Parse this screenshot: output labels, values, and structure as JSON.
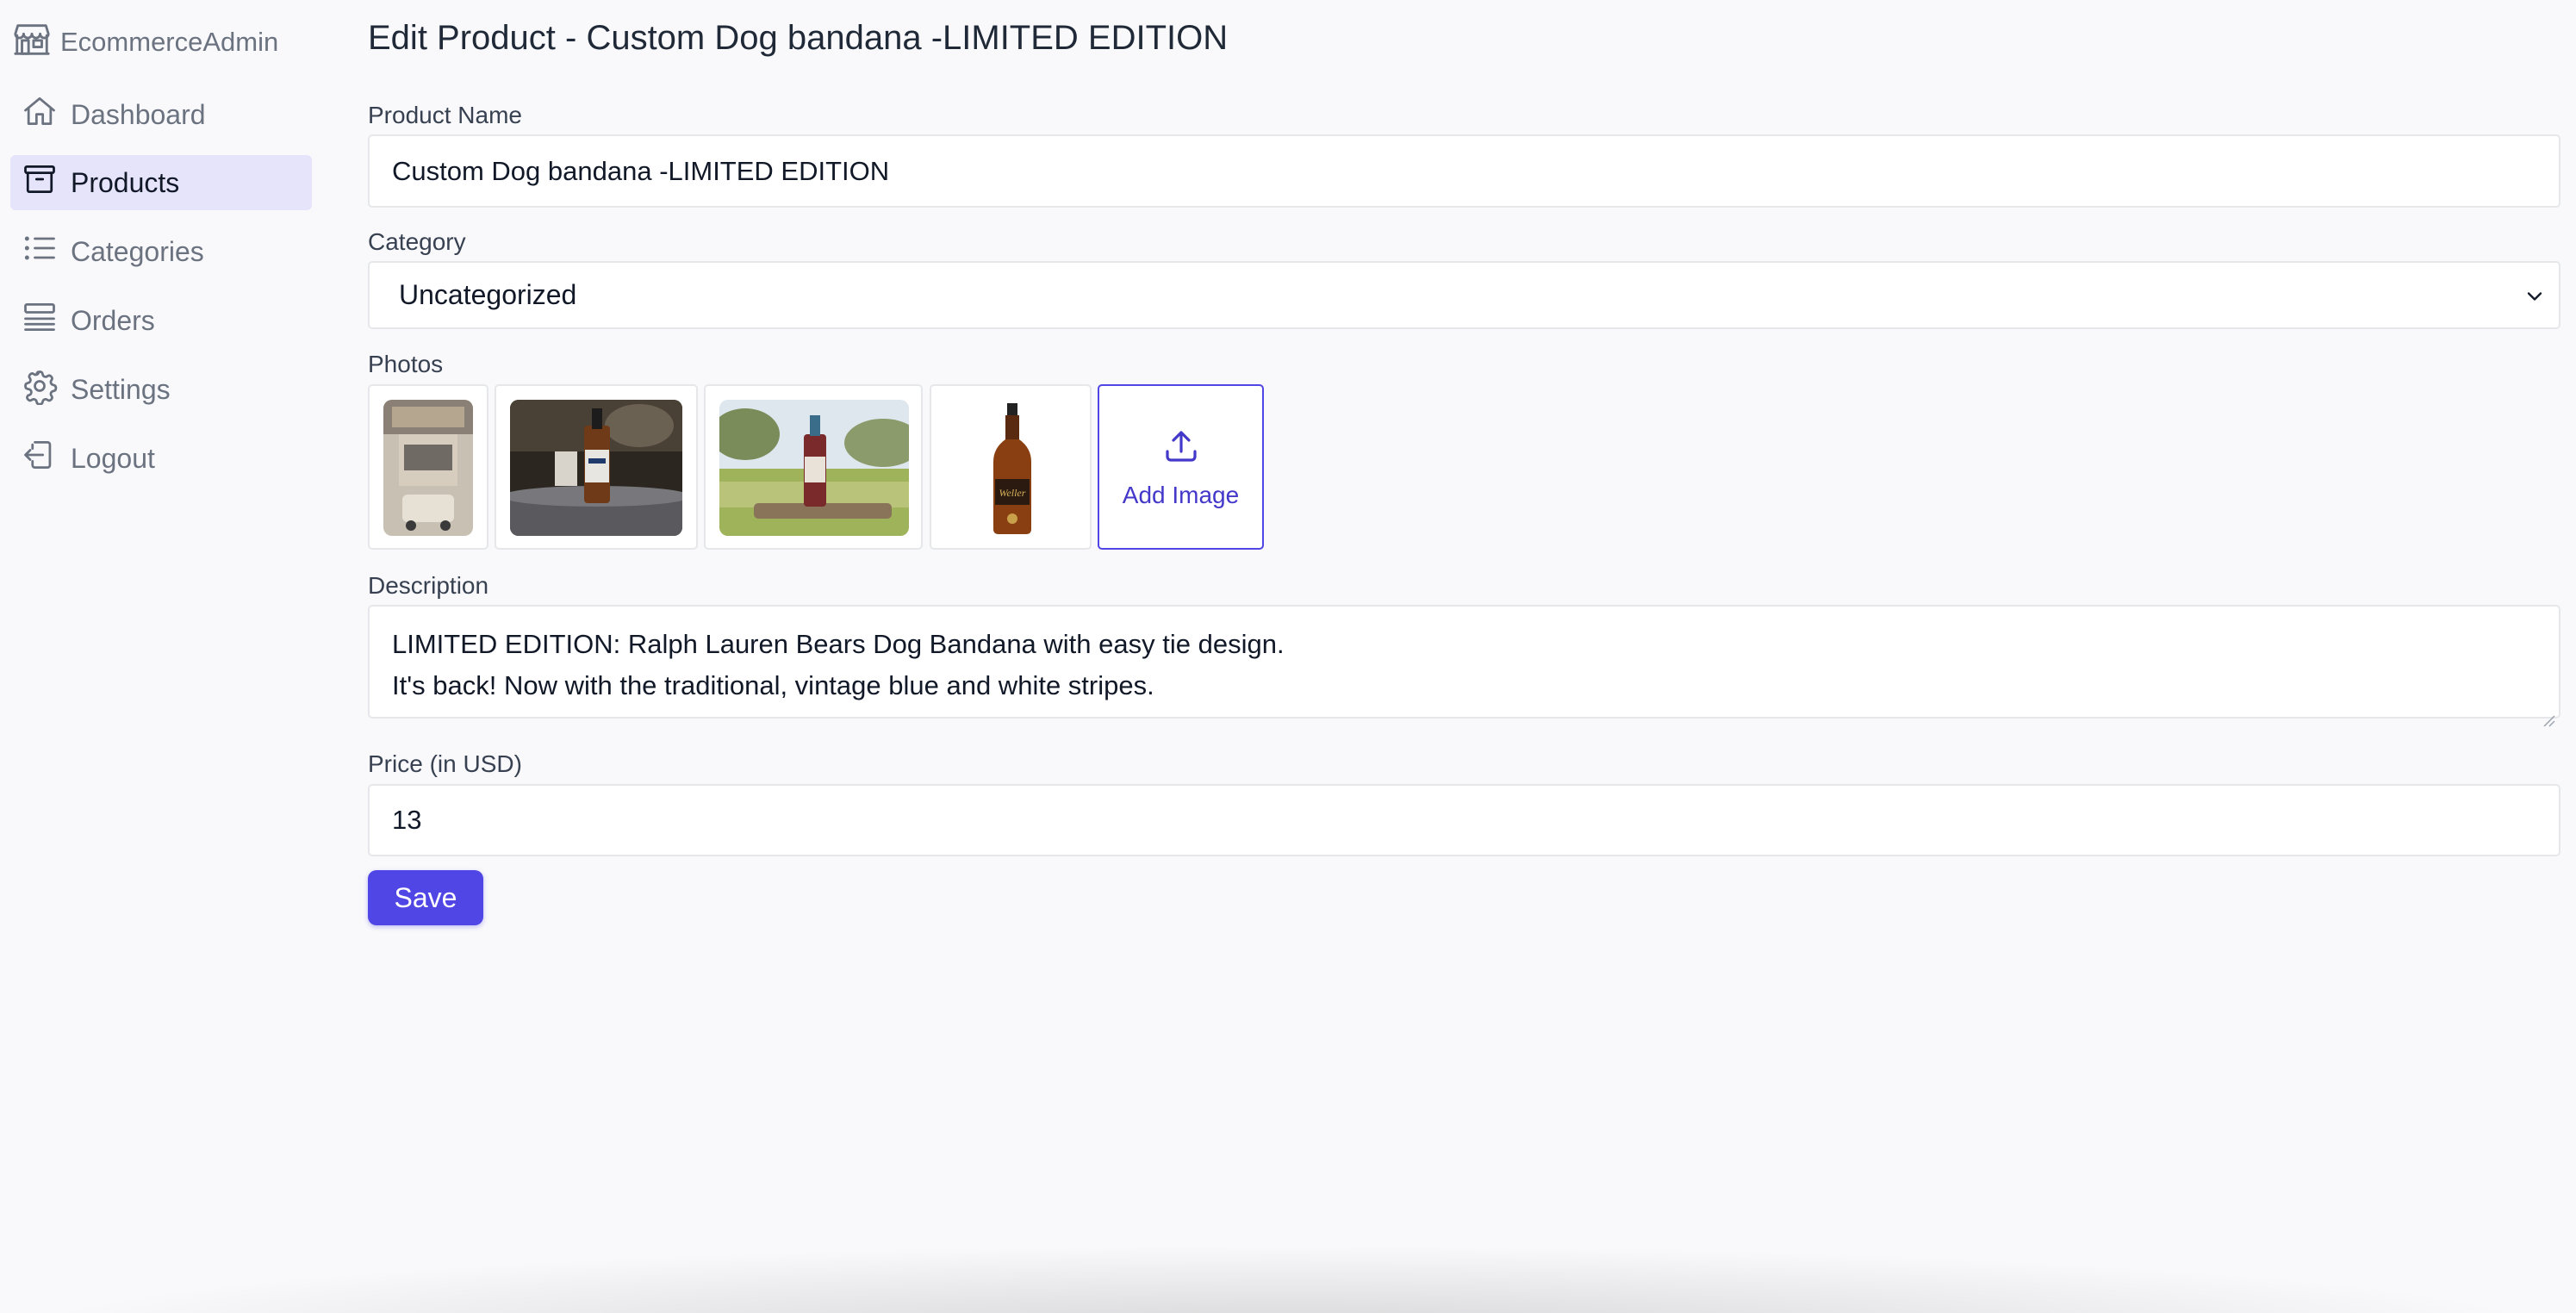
{
  "sidebar": {
    "brand": "EcommerceAdmin",
    "items": [
      {
        "label": "Dashboard",
        "icon": "home-icon"
      },
      {
        "label": "Products",
        "icon": "archive-box-icon",
        "active": true
      },
      {
        "label": "Categories",
        "icon": "list-icon"
      },
      {
        "label": "Orders",
        "icon": "queue-list-icon"
      },
      {
        "label": "Settings",
        "icon": "gear-icon"
      },
      {
        "label": "Logout",
        "icon": "logout-icon"
      }
    ]
  },
  "page": {
    "title": "Edit Product - Custom Dog bandana -LIMITED EDITION"
  },
  "form": {
    "product_name_label": "Product Name",
    "product_name_value": "Custom Dog bandana -LIMITED EDITION",
    "category_label": "Category",
    "category_value": "Uncategorized",
    "photos_label": "Photos",
    "add_image_label": "Add Image",
    "description_label": "Description",
    "description_lines": [
      "LIMITED EDITION: Ralph Lauren Bears Dog Bandana with easy tie design.",
      "It's back! Now with the traditional, vintage blue and white stripes."
    ],
    "price_label": "Price (in USD)",
    "price_value": "13",
    "save_label": "Save"
  },
  "colors": {
    "accent": "#4f46e5",
    "active_nav_bg": "#e6e4fb",
    "page_bg": "#f9f9fb"
  }
}
